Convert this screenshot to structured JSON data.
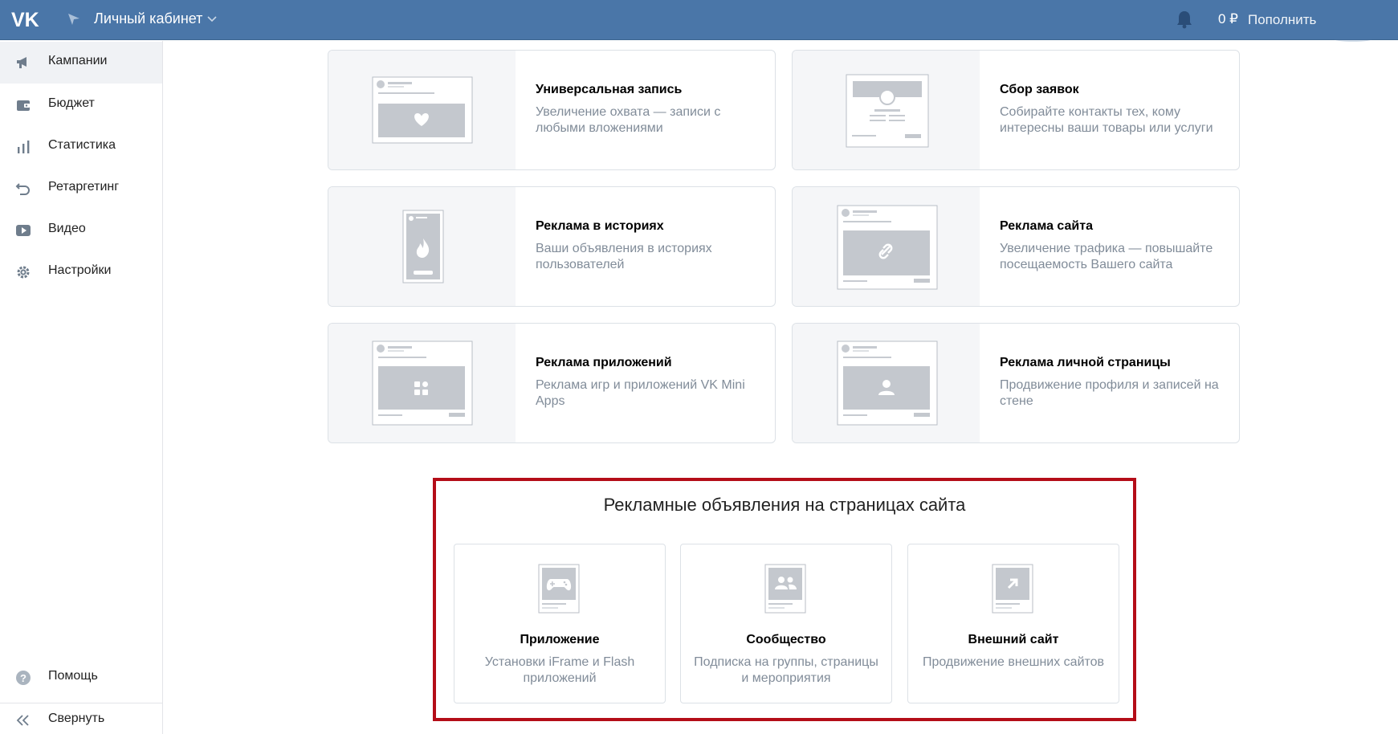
{
  "header": {
    "cabinet_label": "Личный кабинет",
    "balance": "0 ₽",
    "topup_label": "Пополнить"
  },
  "sidebar": {
    "items": [
      {
        "label": "Кампании",
        "icon": "megaphone-icon",
        "active": true
      },
      {
        "label": "Бюджет",
        "icon": "wallet-icon"
      },
      {
        "label": "Статистика",
        "icon": "bar-chart-icon"
      },
      {
        "label": "Ретаргетинг",
        "icon": "retarget-arrow-icon"
      },
      {
        "label": "Видео",
        "icon": "video-play-icon"
      },
      {
        "label": "Настройки",
        "icon": "gear-icon"
      }
    ],
    "help_label": "Помощь",
    "collapse_label": "Свернуть"
  },
  "cards": [
    {
      "title": "Универсальная запись",
      "desc": "Увеличение охвата — записи с любыми вложениями",
      "icon": "heart-post-icon"
    },
    {
      "title": "Сбор заявок",
      "desc": "Собирайте контакты тех, кому интересны ваши товары или услуги",
      "icon": "lead-form-icon"
    },
    {
      "title": "Реклама в историях",
      "desc": "Ваши объявления в историях пользователей",
      "icon": "story-fire-icon"
    },
    {
      "title": "Реклама сайта",
      "desc": "Увеличение трафика — повышайте посещаемость Вашего сайта",
      "icon": "link-post-icon"
    },
    {
      "title": "Реклама приложений",
      "desc": "Реклама игр и приложений VK Mini Apps",
      "icon": "apps-post-icon"
    },
    {
      "title": "Реклама личной страницы",
      "desc": "Продвижение профиля и записей на стене",
      "icon": "profile-post-icon"
    }
  ],
  "site_ads": {
    "title": "Рекламные объявления на страницах сайта",
    "items": [
      {
        "title": "Приложение",
        "desc": "Установки iFrame и Flash приложений",
        "icon": "gamepad-icon"
      },
      {
        "title": "Сообщество",
        "desc": "Подписка на группы, страницы и мероприятия",
        "icon": "community-icon"
      },
      {
        "title": "Внешний сайт",
        "desc": "Продвижение внешних сайтов",
        "icon": "external-arrow-icon"
      }
    ]
  },
  "colors": {
    "header_bg": "#4a76a8",
    "highlight_border": "#b40d18",
    "desc_text": "#818c99"
  }
}
